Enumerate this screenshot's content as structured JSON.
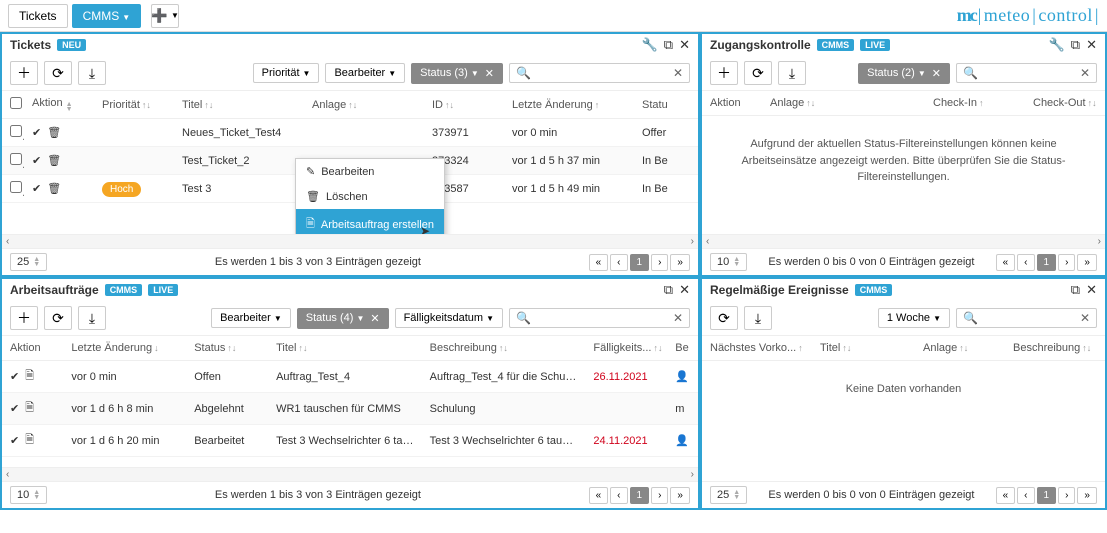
{
  "topbar": {
    "tabs": [
      "Tickets",
      "CMMS"
    ],
    "activeTab": "CMMS"
  },
  "brand": {
    "short": "mc",
    "full1": "meteo",
    "full2": "control"
  },
  "panels": {
    "tickets": {
      "title": "Tickets",
      "badges": [
        "NEU"
      ],
      "filters": {
        "prio": "Priorität",
        "bearbeiter": "Bearbeiter",
        "status": "Status (3)"
      },
      "columns": {
        "aktion": "Aktion",
        "prio": "Priorität",
        "titel": "Titel",
        "anlage": "Anlage",
        "id": "ID",
        "letzte": "Letzte Änderung",
        "status": "Statu"
      },
      "rows": [
        {
          "titel": "Neues_Ticket_Test4",
          "anlage": "",
          "id": "373971",
          "letzte": "vor 0 min",
          "status": "Offer"
        },
        {
          "titel": "Test_Ticket_2",
          "anlage": "",
          "id": "373324",
          "letzte": "vor 1 d 5 h 37 min",
          "status": "In Be"
        },
        {
          "prioLabel": "Hoch",
          "titel": "Test 3",
          "anlage": "",
          "id": "373587",
          "letzte": "vor 1 d 5 h 49 min",
          "status": "In Be"
        }
      ],
      "pager": {
        "size": "25",
        "info": "Es werden 1 bis 3 von 3 Einträgen gezeigt",
        "page": "1"
      },
      "contextMenu": {
        "edit": "Bearbeiten",
        "delete": "Löschen",
        "create": "Arbeitsauftrag erstellen"
      }
    },
    "zugang": {
      "title": "Zugangskontrolle",
      "badges": [
        "CMMS",
        "LIVE"
      ],
      "filters": {
        "status": "Status (2)"
      },
      "columns": {
        "aktion": "Aktion",
        "anlage": "Anlage",
        "checkin": "Check-In",
        "checkout": "Check-Out"
      },
      "empty": "Aufgrund der aktuellen Status-Filtereinstellungen können keine Arbeitseinsätze angezeigt werden. Bitte überprüfen Sie die Status-Filtereinstellungen.",
      "pager": {
        "size": "10",
        "info": "Es werden 0 bis 0 von 0 Einträgen gezeigt",
        "page": "1"
      }
    },
    "auftraege": {
      "title": "Arbeitsaufträge",
      "badges": [
        "CMMS",
        "LIVE"
      ],
      "filters": {
        "bearbeiter": "Bearbeiter",
        "status": "Status (4)",
        "faellig": "Fälligkeitsdatum"
      },
      "columns": {
        "aktion": "Aktion",
        "letzte": "Letzte Änderung",
        "status": "Status",
        "titel": "Titel",
        "beschr": "Beschreibung",
        "faellig": "Fälligkeits...",
        "bearb": "Be"
      },
      "rows": [
        {
          "letzte": "vor 0 min",
          "status": "Offen",
          "titel": "Auftrag_Test_4",
          "beschr": "Auftrag_Test_4 für die Schulu...",
          "faellig": "26.11.2021",
          "red": true,
          "assignee": "blue"
        },
        {
          "letzte": "vor 1 d 6 h 8 min",
          "status": "Abgelehnt",
          "titel": "WR1 tauschen für CMMS",
          "beschr": "Schulung",
          "faellig": "",
          "assignee": "m"
        },
        {
          "letzte": "vor 1 d 6 h 20 min",
          "status": "Bearbeitet",
          "titel": "Test 3 Wechselrichter 6 tausc...",
          "beschr": "Test 3 Wechselrichter 6 tausc...",
          "faellig": "24.11.2021",
          "red": true,
          "assignee": "green"
        }
      ],
      "pager": {
        "size": "10",
        "info": "Es werden 1 bis 3 von 3 Einträgen gezeigt",
        "page": "1"
      }
    },
    "regel": {
      "title": "Regelmäßige Ereignisse",
      "badges": [
        "CMMS"
      ],
      "filters": {
        "range": "1 Woche"
      },
      "columns": {
        "naechst": "Nächstes Vorko...",
        "titel": "Titel",
        "anlage": "Anlage",
        "beschr": "Beschreibung"
      },
      "empty": "Keine Daten vorhanden",
      "pager": {
        "size": "25",
        "info": "Es werden 0 bis 0 von 0 Einträgen gezeigt",
        "page": "1"
      }
    }
  }
}
